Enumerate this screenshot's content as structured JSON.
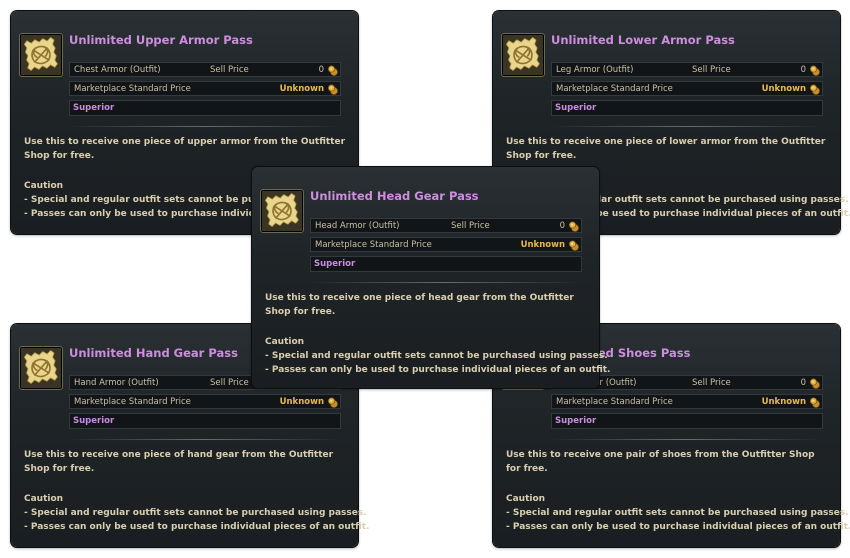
{
  "common": {
    "sell_price_label": "Sell Price",
    "sell_price_value": "0",
    "marketplace_label": "Marketplace Standard Price",
    "marketplace_value": "Unknown",
    "grade": "Superior",
    "caution_title": "Caution",
    "caution_line1": "- Special and regular outfit sets cannot be purchased using passes.",
    "caution_line2": "- Passes can only be used to purchase individual pieces of an outfit."
  },
  "cards": {
    "upper": {
      "title": "Unlimited Upper Armor Pass",
      "slot": "Chest Armor (Outfit)",
      "desc": "Use this to receive one piece of upper armor from the Outfitter Shop for free."
    },
    "lower": {
      "title": "Unlimited Lower Armor Pass",
      "slot": "Leg Armor (Outfit)",
      "desc": "Use this to receive one piece of lower armor from the Outfitter Shop for free."
    },
    "head": {
      "title": "Unlimited Head Gear Pass",
      "slot": "Head Armor (Outfit)",
      "desc": "Use this to receive one piece of head gear from the Outfitter Shop for free."
    },
    "hand": {
      "title": "Unlimited Hand Gear Pass",
      "slot": "Hand Armor (Outfit)",
      "desc": "Use this to receive one piece of hand gear from the Outfitter Shop for free."
    },
    "shoes": {
      "title": "Unlimited Shoes Pass",
      "slot": "Feet Armor (Outfit)",
      "desc": "Use this to receive one pair of shoes from the Outfitter Shop for free."
    }
  },
  "colors": {
    "title": "#cf8de0",
    "unknown": "#e8b94a",
    "panel": "#1f2427"
  },
  "icons": {
    "item": "gold-knot-pass-icon",
    "coin": "gold-coin-pouch-icon"
  }
}
